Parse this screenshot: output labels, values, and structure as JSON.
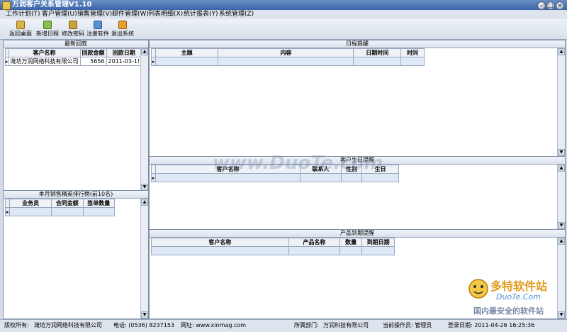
{
  "window": {
    "title": "万润客户关系管理V1.10"
  },
  "menu": [
    "工作计划(T)",
    "客户管理(U)",
    "销售管理(V)",
    "邮件管理(W)",
    "列表明细(X)",
    "统计报表(Y)",
    "系统管理(Z)"
  ],
  "toolbar": [
    {
      "label": "返回桌面",
      "icon": "home-icon"
    },
    {
      "label": "新增日程",
      "icon": "add-schedule-icon"
    },
    {
      "label": "修改密码",
      "icon": "key-icon"
    },
    {
      "label": "注册软件",
      "icon": "register-icon"
    },
    {
      "label": "退出系统",
      "icon": "exit-icon"
    }
  ],
  "latest_payments": {
    "caption": "最新回款",
    "columns": [
      "客户名称",
      "回款金额",
      "回款日期"
    ],
    "rows": [
      [
        "潍坊万润网络科技有限公司",
        "5656",
        "2011-03-1!"
      ]
    ]
  },
  "sales_ranking": {
    "caption": "本月销售精英排行榜(前10名)",
    "columns": [
      "业务员",
      "合同金额",
      "签单数量"
    ]
  },
  "schedule": {
    "caption": "日程提醒",
    "columns": [
      "主题",
      "内容",
      "日期时间",
      "时间"
    ]
  },
  "birthday": {
    "caption": "客户生日提醒",
    "columns": [
      "客户名称",
      "联系人",
      "性别",
      "生日"
    ]
  },
  "product_expiry": {
    "caption": "产品到期提醒",
    "columns": [
      "客户名称",
      "产品名称",
      "数量",
      "到期日期"
    ]
  },
  "status": {
    "copyright_label": "版权所有:",
    "copyright_value": "潍坊万润网络科技有限公司",
    "phone": "电话: (0536) 8237153",
    "website": "网址: www.xinmag.com",
    "department_label": "所属部门:",
    "department_value": "万润科技有限公司",
    "operator": "当前操作员: 管理员",
    "login": "登录日期: 2011-04-26 16:25:36"
  },
  "watermark": {
    "center": "www.DuoTe.com",
    "brand": "多特软件站",
    "brand_url": "DuoTe.Com",
    "slogan": "国内最安全的软件站"
  }
}
